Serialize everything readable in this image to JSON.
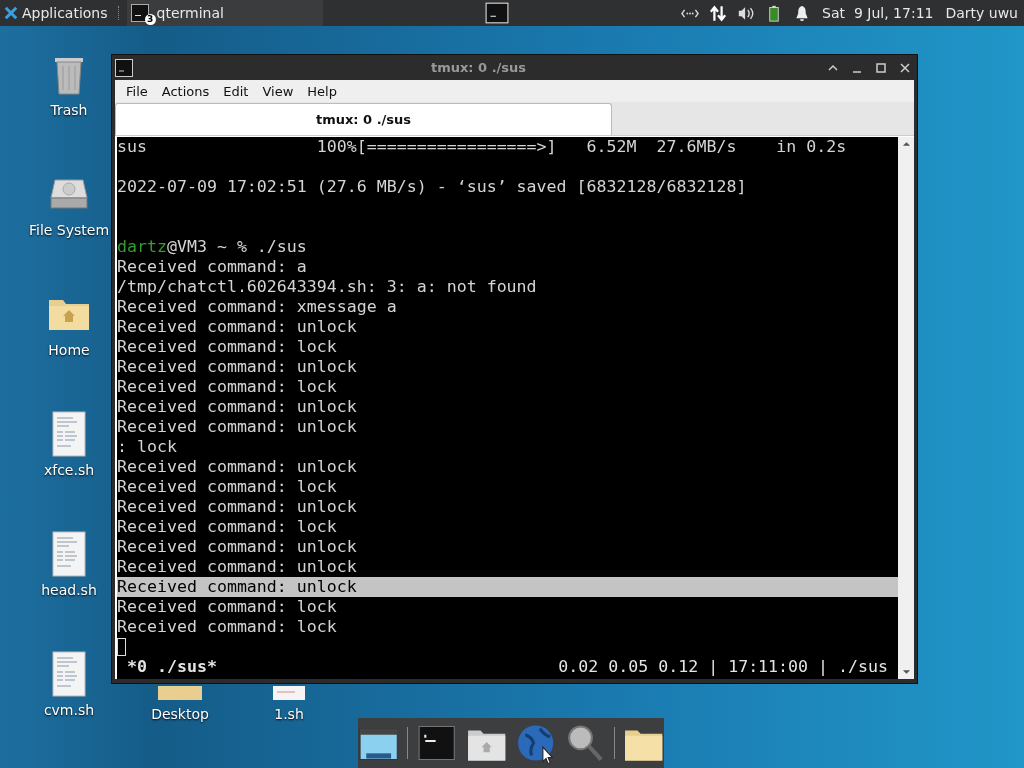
{
  "top_panel": {
    "menu": "Applications",
    "tasks": [
      {
        "label": "qterminal",
        "badge": "3",
        "selected": false
      }
    ],
    "clock": "Sat  9 Jul, 17:11",
    "user": "Darty uwu"
  },
  "desktop_icons": [
    {
      "label": "Trash",
      "kind": "trash"
    },
    {
      "label": "File System",
      "kind": "drive"
    },
    {
      "label": "Home",
      "kind": "home"
    },
    {
      "label": "xfce.sh",
      "kind": "script"
    },
    {
      "label": "head.sh",
      "kind": "script"
    },
    {
      "label": "cvm.sh",
      "kind": "script"
    }
  ],
  "hidden_icons": [
    {
      "label": "Desktop",
      "kind": "folder"
    },
    {
      "label": "1.sh",
      "kind": "script"
    }
  ],
  "window": {
    "title": "tmux: 0 ./sus",
    "menu": [
      "File",
      "Actions",
      "Edit",
      "View",
      "Help"
    ],
    "tabs": [
      {
        "label": "tmux: 0 ./sus",
        "selected": true
      }
    ],
    "terminal": {
      "lines": [
        {
          "kind": "text",
          "text": "sus                 100%[=================>]   6.52M  27.6MB/s    in 0.2s",
          "selected": false
        },
        {
          "kind": "blank",
          "selected": false
        },
        {
          "kind": "text",
          "text": "2022-07-09 17:02:51 (27.6 MB/s) - ‘sus’ saved [6832128/6832128]",
          "selected": false
        },
        {
          "kind": "blank",
          "selected": false
        },
        {
          "kind": "blank",
          "selected": false
        },
        {
          "kind": "prompt",
          "user": "dartz",
          "text": "@VM3 ~ % ./sus",
          "selected": false
        },
        {
          "kind": "text",
          "text": "Received command: a",
          "selected": false
        },
        {
          "kind": "text",
          "text": "/tmp/chatctl.602643394.sh: 3: a: not found",
          "selected": false
        },
        {
          "kind": "text",
          "text": "Received command: xmessage a",
          "selected": false
        },
        {
          "kind": "text",
          "text": "Received command: unlock",
          "selected": false
        },
        {
          "kind": "text",
          "text": "Received command: lock",
          "selected": false
        },
        {
          "kind": "text",
          "text": "Received command: unlock",
          "selected": false
        },
        {
          "kind": "text",
          "text": "Received command: lock",
          "selected": false
        },
        {
          "kind": "text",
          "text": "Received command: unlock",
          "selected": false
        },
        {
          "kind": "text",
          "text": "Received command: unlock",
          "selected": false
        },
        {
          "kind": "text",
          "text": ": lock",
          "selected": false
        },
        {
          "kind": "text",
          "text": "Received command: unlock",
          "selected": false
        },
        {
          "kind": "text",
          "text": "Received command: lock",
          "selected": false
        },
        {
          "kind": "text",
          "text": "Received command: unlock",
          "selected": false
        },
        {
          "kind": "text",
          "text": "Received command: lock",
          "selected": false
        },
        {
          "kind": "text",
          "text": "Received command: unlock",
          "selected": false
        },
        {
          "kind": "text",
          "text": "Received command: unlock",
          "selected": false
        },
        {
          "kind": "text",
          "text": "Received command: unlock",
          "selected": true
        },
        {
          "kind": "text",
          "text": "Received command: lock",
          "selected": false
        },
        {
          "kind": "text",
          "text": "Received command: lock",
          "selected": false
        },
        {
          "kind": "cursor",
          "selected": false
        }
      ],
      "status_left": "*0 ./sus*",
      "status_right": "0.02 0.05 0.12 | 17:11:00 | ./sus"
    }
  },
  "dock": [
    {
      "kind": "desktop"
    },
    {
      "kind": "terminal"
    },
    {
      "kind": "home"
    },
    {
      "kind": "web"
    },
    {
      "kind": "search"
    },
    {
      "kind": "folder"
    }
  ]
}
